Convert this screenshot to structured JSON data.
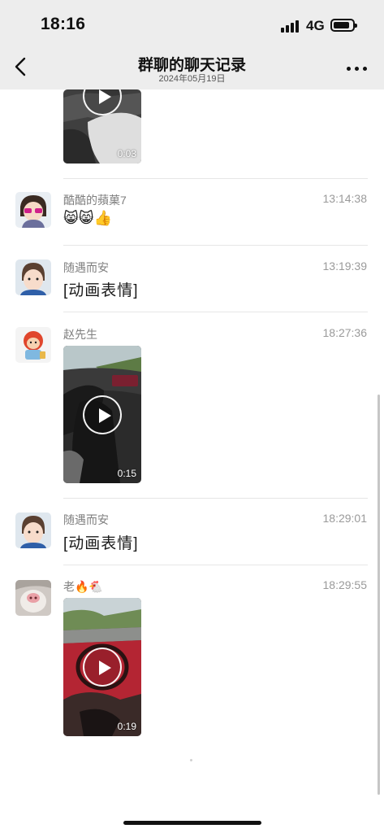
{
  "status_bar": {
    "time": "18:16",
    "network": "4G",
    "battery_level": 0.85
  },
  "header": {
    "title": "群聊的聊天记录",
    "subtitle": "2024年05月19日"
  },
  "messages": [
    {
      "type": "video",
      "duration": "0:03"
    },
    {
      "sender": "酷酷的蘋菓7",
      "time": "13:14:38",
      "type": "emoji",
      "emoji": "😸😸👍"
    },
    {
      "sender": "随遇而安",
      "time": "13:19:39",
      "type": "text",
      "text": "[动画表情]"
    },
    {
      "sender": "赵先生",
      "time": "18:27:36",
      "type": "video",
      "duration": "0:15"
    },
    {
      "sender": "随遇而安",
      "time": "18:29:01",
      "type": "text",
      "text": "[动画表情]"
    },
    {
      "sender": "老🔥🐔",
      "time": "18:29:55",
      "type": "video",
      "duration": "0:19"
    }
  ],
  "icons": {
    "back": "chevron-left-icon",
    "more": "more-horizontal-icon",
    "play": "play-icon",
    "signal": "cellular-signal-icon",
    "battery": "battery-icon"
  },
  "colors": {
    "header_bg": "#ededed",
    "background": "#ffffff",
    "sender_text": "#7f7f7f",
    "time_text": "#9a9a9a",
    "divider": "#e6e6e6"
  }
}
